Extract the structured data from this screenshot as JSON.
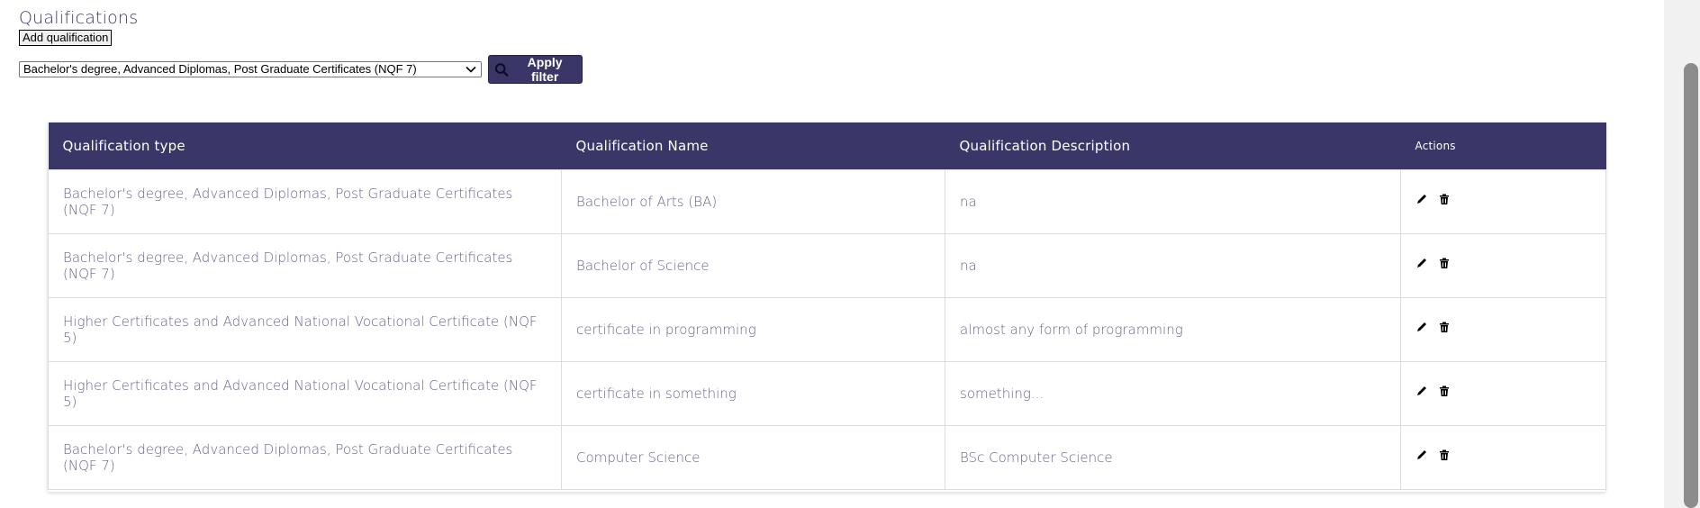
{
  "header": {
    "title": "Qualifications",
    "add_button_label": "Add qualification"
  },
  "filter": {
    "selected_value": "Bachelor's degree, Advanced Diplomas, Post Graduate Certificates (NQF 7)",
    "apply_label": "Apply filter"
  },
  "table": {
    "columns": {
      "type": "Qualification type",
      "name": "Qualification Name",
      "description": "Qualification Description",
      "actions": "Actions"
    },
    "rows": [
      {
        "type": "Bachelor's degree, Advanced Diplomas, Post Graduate Certificates (NQF 7)",
        "name": "Bachelor of Arts (BA)",
        "description": "na"
      },
      {
        "type": "Bachelor's degree, Advanced Diplomas, Post Graduate Certificates (NQF 7)",
        "name": "Bachelor of Science",
        "description": "na"
      },
      {
        "type": "Higher Certificates and Advanced National Vocational Certificate (NQF 5)",
        "name": "certificate in programming",
        "description": "almost any form of programming"
      },
      {
        "type": "Higher Certificates and Advanced National Vocational Certificate (NQF 5)",
        "name": "certificate in something",
        "description": "something..."
      },
      {
        "type": "Bachelor's degree, Advanced Diplomas, Post Graduate Certificates (NQF 7)",
        "name": "Computer Science",
        "description": "BSc Computer Science"
      }
    ]
  },
  "icons": {
    "search": "search-icon",
    "chevron": "chevron-down-icon",
    "edit": "pencil-icon",
    "delete": "trash-icon"
  },
  "colors": {
    "primary": "#3a3668",
    "cell_text": "#67648f"
  }
}
